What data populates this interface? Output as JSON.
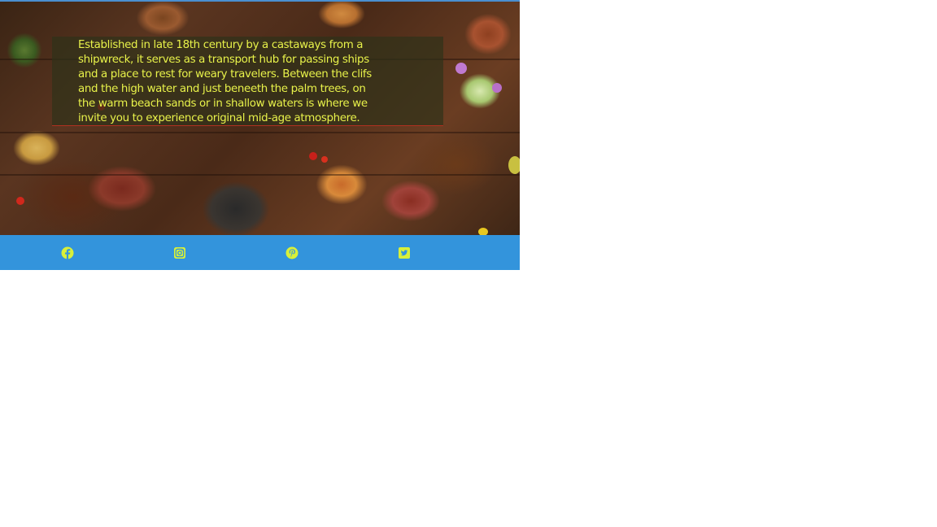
{
  "hero": {
    "description": "Established in late 18th century by a castaways from a shipwreck, it serves as a transport hub for passing ships and a place to rest for weary travelers. Between the clifs and the high water and just beneeth the palm trees, on the warm beach sands or in shallow waters is where we invite you to experience original mid-age atmosphere."
  },
  "social": {
    "icons": [
      "facebook-icon",
      "instagram-icon",
      "pinterest-icon",
      "twitter-icon"
    ],
    "icon_color": "#d8f03a",
    "bar_color": "#3394dc"
  },
  "colors": {
    "text": "#e8f24a",
    "overlay": "#2d3219",
    "accent_line": "#b03020"
  }
}
